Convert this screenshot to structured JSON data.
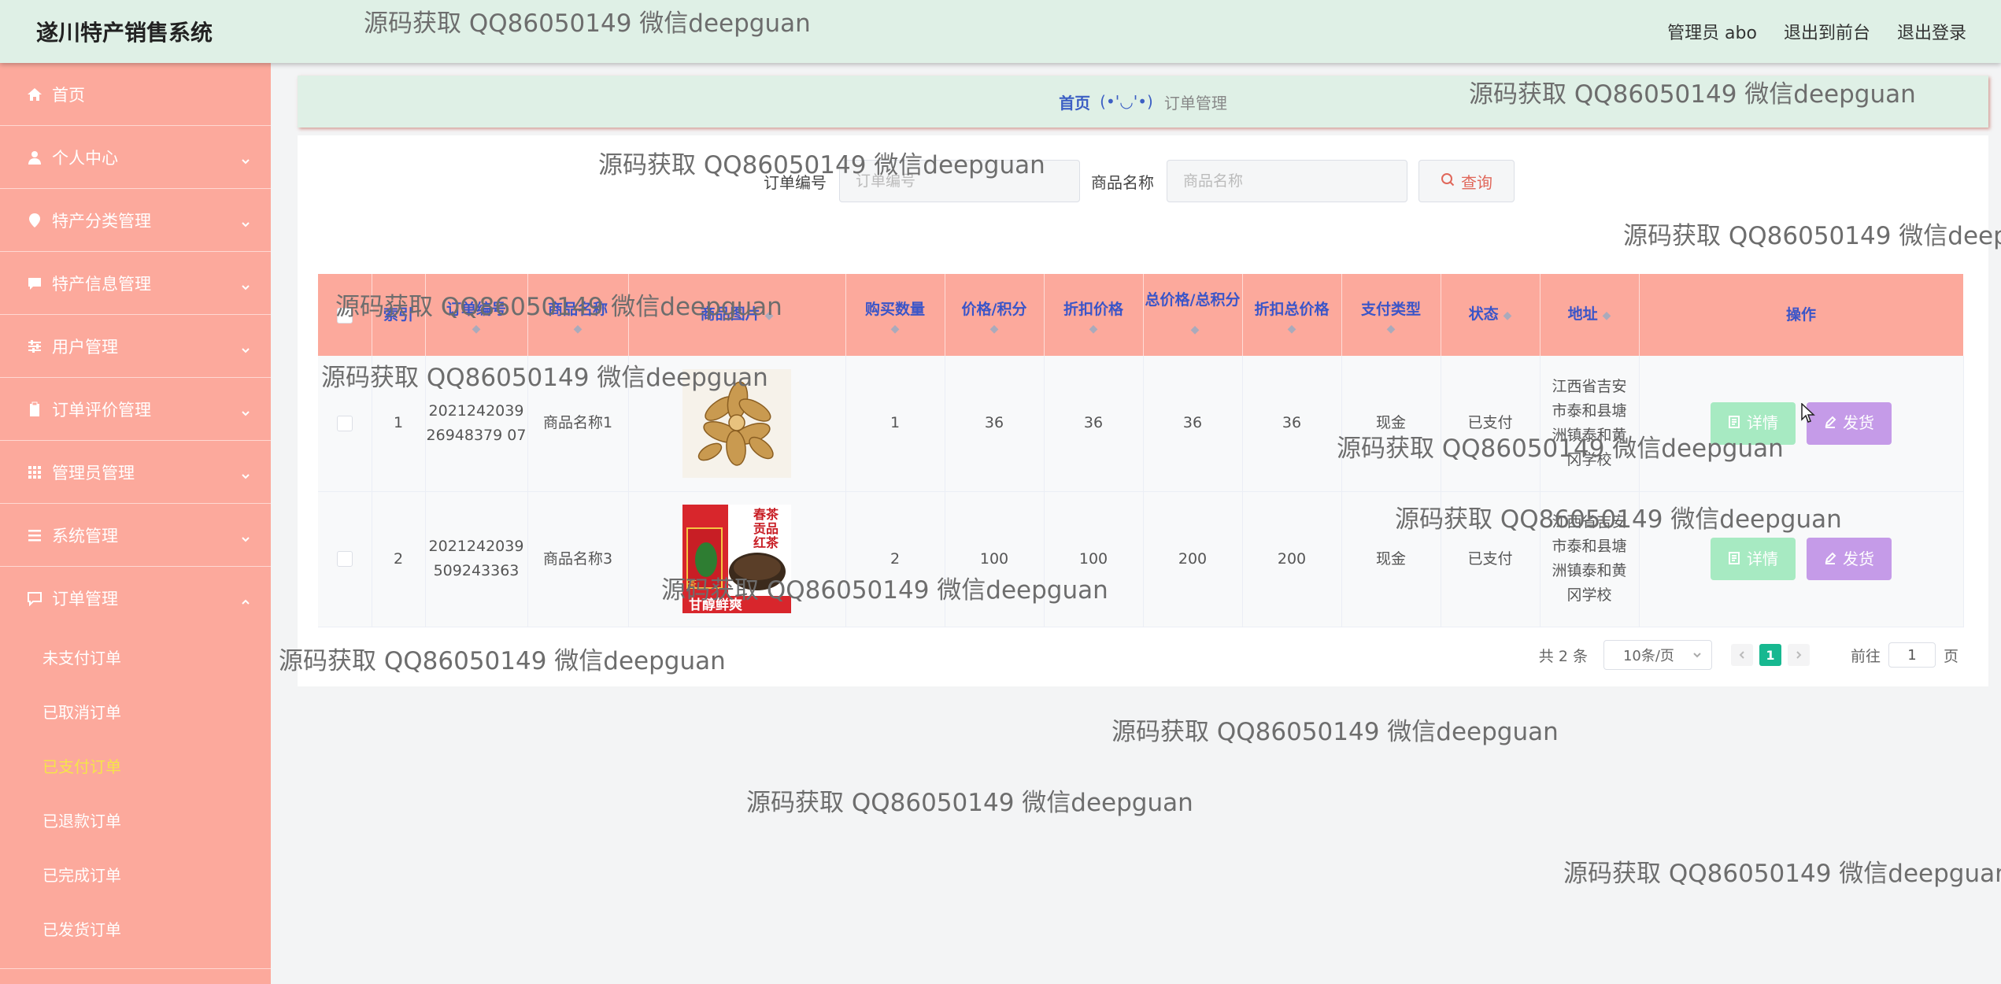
{
  "header": {
    "app_title": "遂川特产销售系统",
    "admin_label": "管理员 abo",
    "back_front_label": "退出到前台",
    "logout_label": "退出登录"
  },
  "sidebar": {
    "items": [
      {
        "label": "首页",
        "icon": "home-icon",
        "expandable": false
      },
      {
        "label": "个人中心",
        "icon": "user-icon",
        "expandable": true
      },
      {
        "label": "特产分类管理",
        "icon": "location-pin-icon",
        "expandable": true
      },
      {
        "label": "特产信息管理",
        "icon": "chat-bubble-icon",
        "expandable": true
      },
      {
        "label": "用户管理",
        "icon": "sliders-icon",
        "expandable": true
      },
      {
        "label": "订单评价管理",
        "icon": "clipboard-icon",
        "expandable": true
      },
      {
        "label": "管理员管理",
        "icon": "grid-icon",
        "expandable": true
      },
      {
        "label": "系统管理",
        "icon": "menu-icon",
        "expandable": true
      },
      {
        "label": "订单管理",
        "icon": "message-icon",
        "expandable": true,
        "open": true
      }
    ],
    "order_submenu": [
      {
        "label": "未支付订单",
        "active": false
      },
      {
        "label": "已取消订单",
        "active": false
      },
      {
        "label": "已支付订单",
        "active": true
      },
      {
        "label": "已退款订单",
        "active": false
      },
      {
        "label": "已完成订单",
        "active": false
      },
      {
        "label": "已发货订单",
        "active": false
      }
    ]
  },
  "breadcrumb": {
    "home": "首页",
    "separator": "(•'◡'•)",
    "current": "订单管理"
  },
  "search": {
    "order_no_label": "订单编号",
    "order_no_placeholder": "订单编号",
    "product_name_label": "商品名称",
    "product_name_placeholder": "商品名称",
    "query_label": "查询"
  },
  "table": {
    "columns": {
      "index": "索引",
      "order_no": "订单编号",
      "product_name": "商品名称",
      "product_image": "商品图片",
      "quantity": "购买数量",
      "price": "价格/积分",
      "discount_price": "折扣价格",
      "total_price": "总价格/总积分",
      "discount_total": "折扣总价格",
      "pay_type": "支付类型",
      "status": "状态",
      "address": "地址",
      "actions": "操作"
    },
    "rows": [
      {
        "index": "1",
        "order_no": "202124203926948379 07",
        "product_name": "商品名称1",
        "quantity": "1",
        "price": "36",
        "discount_price": "36",
        "total_price": "36",
        "discount_total": "36",
        "pay_type": "现金",
        "status": "已支付",
        "address": "江西省吉安市泰和县塘洲镇泰和黄冈学校",
        "detail_label": "详情",
        "ship_label": "发货"
      },
      {
        "index": "2",
        "order_no": "2021242039509243363",
        "product_name": "商品名称3",
        "quantity": "2",
        "price": "100",
        "discount_price": "100",
        "total_price": "200",
        "discount_total": "200",
        "pay_type": "现金",
        "status": "已支付",
        "address": "江西省吉安市泰和县塘洲镇泰和黄冈学校",
        "detail_label": "详情",
        "ship_label": "发货"
      }
    ]
  },
  "pagination": {
    "total_label": "共 2 条",
    "page_size_label": "10条/页",
    "current_page": "1",
    "goto_prefix": "前往",
    "goto_value": "1",
    "goto_suffix": "页"
  },
  "tea_image_text": {
    "left_vertical": "茶",
    "top_right_1": "春茶",
    "top_right_2": "贡品",
    "top_right_3": "红茶",
    "bottom": "甘醇鲜爽"
  },
  "watermark_text": "源码获取 QQ86050149 微信deepguan",
  "colors": {
    "header_bg": "#dff0e6",
    "sidebar_bg": "#fca99c",
    "table_header_bg": "#fca99c",
    "header_text_blue": "#3a55c8",
    "active_submenu": "#f5e44a",
    "detail_button": "#a7eac2",
    "ship_button": "#c59be8",
    "pager_active": "#17b890"
  }
}
